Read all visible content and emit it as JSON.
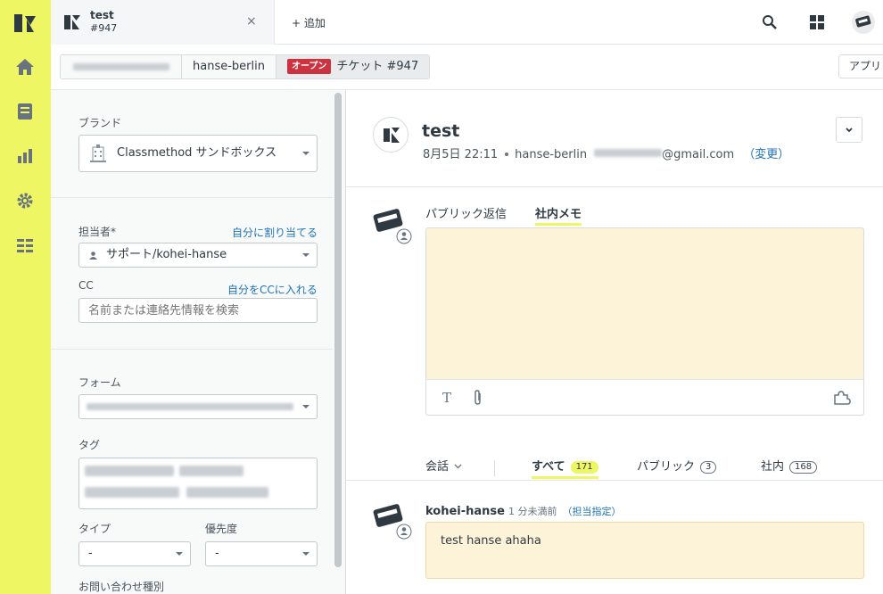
{
  "tab": {
    "title": "test",
    "subtitle": "#947",
    "close": "×"
  },
  "add_label": "+ 追加",
  "breadcrumbs": {
    "org": "",
    "user": "hanse-berlin",
    "status": "オープン",
    "ticket": "チケット #947"
  },
  "apply_label": "アプリ",
  "sidebar": {
    "brand_label": "ブランド",
    "brand_value": "Classmethod サンドボックス",
    "assignee_label": "担当者*",
    "assign_self": "自分に割り当てる",
    "assignee_value": "サポート/kohei-hanse",
    "cc_label": "CC",
    "cc_self": "自分をCCに入れる",
    "cc_placeholder": "名前または連絡先情報を検索",
    "form_label": "フォーム",
    "tags_label": "タグ",
    "type_label": "タイプ",
    "type_value": "-",
    "priority_label": "優先度",
    "priority_value": "-",
    "inquiry_label": "お問い合わせ種別"
  },
  "ticket": {
    "title": "test",
    "date": "8月5日 22:11",
    "requester": "hanse-berlin",
    "email_suffix": "@gmail.com",
    "change_link": "（変更）"
  },
  "reply": {
    "public_tab": "パブリック返信",
    "internal_tab": "社内メモ"
  },
  "filters": {
    "conversation": "会話",
    "all": "すべて",
    "all_count": "171",
    "public": "パブリック",
    "public_count": "3",
    "internal": "社内",
    "internal_count": "168"
  },
  "comment": {
    "author": "kohei-hanse",
    "time": "1 分未満前",
    "assigned": "（担当指定）",
    "body": "test hanse ahaha"
  },
  "colors": {
    "rail": "#eef763",
    "note": "#fdf3d8",
    "open_badge": "#cc3340",
    "link": "#1f73b7"
  }
}
